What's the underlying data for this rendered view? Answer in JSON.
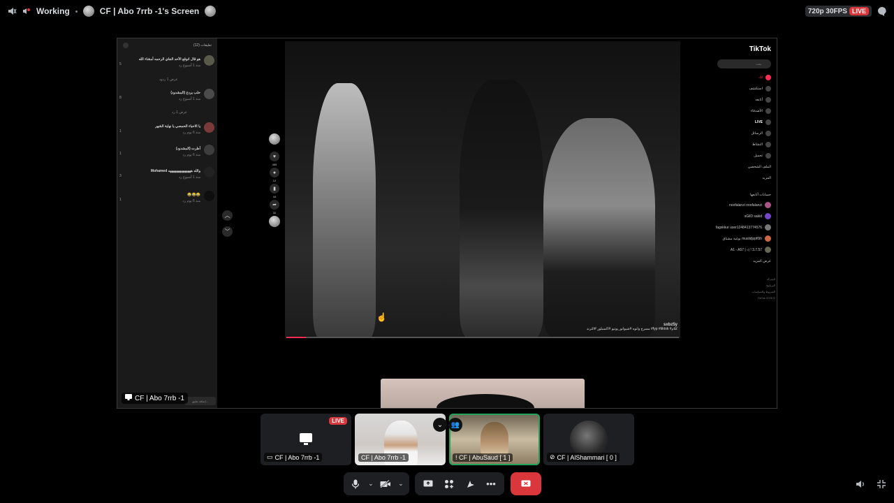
{
  "topbar": {
    "channel": "Working",
    "stream_title": "CF | Abo 7rrb -1's Screen",
    "quality": "720p 30FPS",
    "live": "LIVE"
  },
  "stream": {
    "name": "CF | Abo 7rrb -1",
    "comments": {
      "header": "تعليقات (12)",
      "input_placeholder": "إضافة تعليق...",
      "items": [
        {
          "text": "هو قال انوقع الأحد الجاي الرحمه أمشاء الله",
          "meta": "منذ 1 أسبوع  رد",
          "likes": "5",
          "replies": "عرض 1 ردود"
        },
        {
          "text": "حلب يردع (المشدود)",
          "meta": "منذ 1 أسبوع  رد",
          "likes": "8",
          "replies": "عرض 1 رد"
        },
        {
          "text": "يا الاحباء الحمصي يا نهاية الشهر",
          "meta": "منذ 6 يوم  رد",
          "likes": "1"
        },
        {
          "text": "أطرت (المشدود)",
          "meta": "منذ 6 يوم  رد",
          "likes": "1"
        },
        {
          "text": "Mohamed والله ‏ههههههههههههههه",
          "meta": "منذ 1 أسبوع  رد",
          "likes": "3"
        },
        {
          "text": "😂😂😂",
          "meta": "منذ 6 يوم  رد",
          "likes": "1"
        }
      ]
    },
    "rail": {
      "likes": "455",
      "comments": "12",
      "saves": "44",
      "shares": "32"
    },
    "video": {
      "user": "sxbz5y",
      "caption": "مسرح وانوه #شبوانو_يوتيو #اكسبلور #الترند #fyp #tiktok #كلام",
      "progress": 0.05
    },
    "tiktok": {
      "brand": "TikTok",
      "search_placeholder": "بحث",
      "menu": [
        "لك",
        "استكشف",
        "أتابعه",
        "الأصدقاء",
        "LIVE",
        "الرسائل",
        "النشاط",
        "تحميل",
        "الملف الشخصي",
        "المزيد"
      ],
      "following_title": "حسابات أتابعها",
      "following": [
        "noofalanzi noofalanzi",
        "sGilD sakid",
        "fagxkkur user1248413774576",
        "بوغية مشتاق muslidjzpf0ih",
        "A1 - A57 | ◁ ! 3.7.57"
      ],
      "see_more": "عرض المزيد",
      "footer": [
        "الشركة",
        "البرنامج",
        "الشروط والسياسات",
        "TikTok 2025 ©"
      ]
    }
  },
  "tiles": [
    {
      "label": "CF | Abo 7rrb -1",
      "live": "LIVE",
      "kind": "screen"
    },
    {
      "label": "CF | Abo 7rrb -1",
      "kind": "camera"
    },
    {
      "label": "! CF | AbuSaud [ 1 ]",
      "kind": "camera",
      "speaking": true
    },
    {
      "label": "CF | AlShammari [ 0 ]",
      "kind": "avatar"
    }
  ],
  "colors": {
    "live": "#da373c",
    "speaking": "#23a559",
    "tiktok_red": "#fe2c55"
  }
}
